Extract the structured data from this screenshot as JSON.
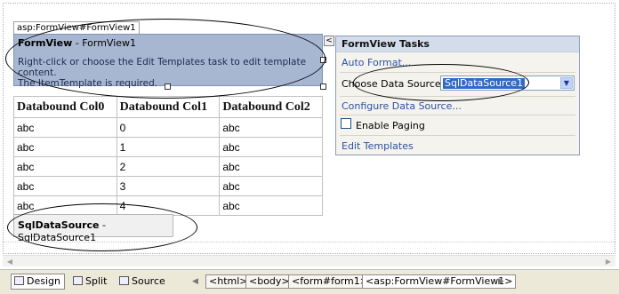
{
  "formview": {
    "tag_label": "asp:FormView#FormView1",
    "title_bold": "FormView",
    "title_rest": " - FormView1",
    "message_line1": "Right-click or choose the Edit Templates task to edit template content.",
    "message_line2": "The ItemTemplate is required.",
    "smart_tag_glyph": "<"
  },
  "table": {
    "headers": [
      "Databound Col0",
      "Databound Col1",
      "Databound Col2"
    ],
    "rows": [
      [
        "abc",
        "0",
        "abc"
      ],
      [
        "abc",
        "1",
        "abc"
      ],
      [
        "abc",
        "2",
        "abc"
      ],
      [
        "abc",
        "3",
        "abc"
      ],
      [
        "abc",
        "4",
        "abc"
      ]
    ]
  },
  "sqldatasource": {
    "bold": "SqlDataSource",
    "rest": " - SqlDataSource1"
  },
  "tasks": {
    "header": "FormView Tasks",
    "auto_format": "Auto Format...",
    "choose_label": "Choose Data Source:",
    "choose_value": "SqlDataSource1",
    "configure": "Configure Data Source...",
    "enable_paging": "Enable Paging",
    "edit_templates": "Edit Templates"
  },
  "bottom": {
    "views": [
      "Design",
      "Split",
      "Source"
    ],
    "breadcrumbs": [
      "<html>",
      "<body>",
      "<form#form1>",
      "<asp:FormView#FormView1>"
    ]
  },
  "colors": {
    "formview_bg": "#a7b7d2",
    "link": "#2d50a4",
    "selection": "#316ac5"
  }
}
